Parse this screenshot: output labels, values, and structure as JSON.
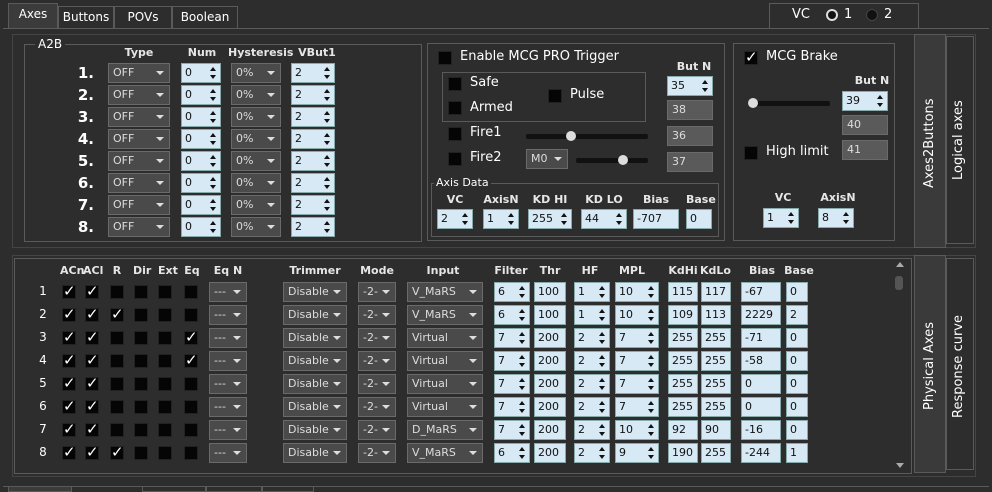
{
  "tabs": [
    "Axes",
    "Buttons",
    "POVs",
    "Boolean"
  ],
  "vc": {
    "label": "VC",
    "opt1": "1",
    "opt2": "2"
  },
  "a2b": {
    "title": "A2B",
    "headers": [
      "Type",
      "Num",
      "Hysteresis",
      "VBut1"
    ],
    "rows": [
      {
        "n": "1.",
        "type": "OFF",
        "num": "0",
        "hyst": "0%",
        "vbut": "2"
      },
      {
        "n": "2.",
        "type": "OFF",
        "num": "0",
        "hyst": "0%",
        "vbut": "2"
      },
      {
        "n": "3.",
        "type": "OFF",
        "num": "0",
        "hyst": "0%",
        "vbut": "2"
      },
      {
        "n": "4.",
        "type": "OFF",
        "num": "0",
        "hyst": "0%",
        "vbut": "2"
      },
      {
        "n": "5.",
        "type": "OFF",
        "num": "0",
        "hyst": "0%",
        "vbut": "2"
      },
      {
        "n": "6.",
        "type": "OFF",
        "num": "0",
        "hyst": "0%",
        "vbut": "2"
      },
      {
        "n": "7.",
        "type": "OFF",
        "num": "0",
        "hyst": "0%",
        "vbut": "2"
      },
      {
        "n": "8.",
        "type": "OFF",
        "num": "0",
        "hyst": "0%",
        "vbut": "2"
      }
    ]
  },
  "mcg": {
    "enable": "Enable MCG PRO Trigger",
    "safe": "Safe",
    "armed": "Armed",
    "pulse": "Pulse",
    "fire1": "Fire1",
    "fire2": "Fire2",
    "m0": "M0",
    "butn": "But N",
    "butvals": [
      "35",
      "38",
      "36",
      "37"
    ],
    "axis_data": "Axis Data",
    "ad_headers": [
      "VC",
      "AxisN",
      "KD HI",
      "KD LO",
      "Bias",
      "Base"
    ],
    "ad_vals": [
      "2",
      "1",
      "255",
      "44",
      "-707",
      "0"
    ]
  },
  "brake": {
    "label": "MCG Brake",
    "butn": "But N",
    "butvals": [
      "39",
      "40",
      "41"
    ],
    "high": "High limit",
    "vc_label": "VC",
    "axisn_label": "AxisN",
    "vc": "1",
    "axisn": "8"
  },
  "side": {
    "axes2buttons": "Axes2Buttons",
    "logical": "Logical axes",
    "physical": "Physical Axes",
    "response": "Response curve"
  },
  "phys": {
    "headers": [
      "ACn",
      "ACl",
      "R",
      "Dir",
      "Ext",
      "Eq",
      "Eq N",
      "Trimmer",
      "Mode",
      "Input",
      "Filter",
      "Thr",
      "HF",
      "MPL",
      "KdHi",
      "KdLo",
      "Bias",
      "Base"
    ],
    "rows": [
      {
        "n": "1",
        "acn": true,
        "acl": true,
        "r": false,
        "dir": false,
        "ext": false,
        "eq": false,
        "eqn": "---",
        "trim": "Disable",
        "mode": "-2-",
        "input": "V_MaRS",
        "filter": "6",
        "thr": "100",
        "hf": "1",
        "mpl": "10",
        "kdhi": "115",
        "kdlo": "117",
        "bias": "-67",
        "base": "0"
      },
      {
        "n": "2",
        "acn": true,
        "acl": true,
        "r": true,
        "dir": false,
        "ext": false,
        "eq": false,
        "eqn": "---",
        "trim": "Disable",
        "mode": "-2-",
        "input": "V_MaRS",
        "filter": "6",
        "thr": "100",
        "hf": "1",
        "mpl": "10",
        "kdhi": "109",
        "kdlo": "113",
        "bias": "2229",
        "base": "2"
      },
      {
        "n": "3",
        "acn": true,
        "acl": true,
        "r": false,
        "dir": false,
        "ext": false,
        "eq": true,
        "eqn": "---",
        "trim": "Disable",
        "mode": "-2-",
        "input": "Virtual",
        "filter": "7",
        "thr": "200",
        "hf": "2",
        "mpl": "7",
        "kdhi": "255",
        "kdlo": "255",
        "bias": "-71",
        "base": "0"
      },
      {
        "n": "4",
        "acn": true,
        "acl": true,
        "r": false,
        "dir": false,
        "ext": false,
        "eq": true,
        "eqn": "---",
        "trim": "Disable",
        "mode": "-2-",
        "input": "Virtual",
        "filter": "7",
        "thr": "200",
        "hf": "2",
        "mpl": "7",
        "kdhi": "255",
        "kdlo": "255",
        "bias": "-58",
        "base": "0"
      },
      {
        "n": "5",
        "acn": true,
        "acl": true,
        "r": false,
        "dir": false,
        "ext": false,
        "eq": false,
        "eqn": "---",
        "trim": "Disable",
        "mode": "-2-",
        "input": "Virtual",
        "filter": "7",
        "thr": "200",
        "hf": "2",
        "mpl": "7",
        "kdhi": "255",
        "kdlo": "255",
        "bias": "0",
        "base": "0"
      },
      {
        "n": "6",
        "acn": true,
        "acl": true,
        "r": false,
        "dir": false,
        "ext": false,
        "eq": false,
        "eqn": "---",
        "trim": "Disable",
        "mode": "-2-",
        "input": "Virtual",
        "filter": "7",
        "thr": "200",
        "hf": "2",
        "mpl": "7",
        "kdhi": "255",
        "kdlo": "255",
        "bias": "0",
        "base": "0"
      },
      {
        "n": "7",
        "acn": true,
        "acl": true,
        "r": false,
        "dir": false,
        "ext": false,
        "eq": false,
        "eqn": "---",
        "trim": "Disable",
        "mode": "-2-",
        "input": "D_MaRS",
        "filter": "7",
        "thr": "200",
        "hf": "2",
        "mpl": "10",
        "kdhi": "92",
        "kdlo": "90",
        "bias": "-16",
        "base": "0"
      },
      {
        "n": "8",
        "acn": true,
        "acl": true,
        "r": true,
        "dir": false,
        "ext": false,
        "eq": false,
        "eqn": "---",
        "trim": "Disable",
        "mode": "-2-",
        "input": "V_MaRS",
        "filter": "6",
        "thr": "200",
        "hf": "2",
        "mpl": "9",
        "kdhi": "190",
        "kdlo": "255",
        "bias": "-244",
        "base": "1"
      }
    ]
  },
  "colors": {
    "bg": "#2d2d2d",
    "field": "#d6e9f5",
    "check": "#050505"
  }
}
